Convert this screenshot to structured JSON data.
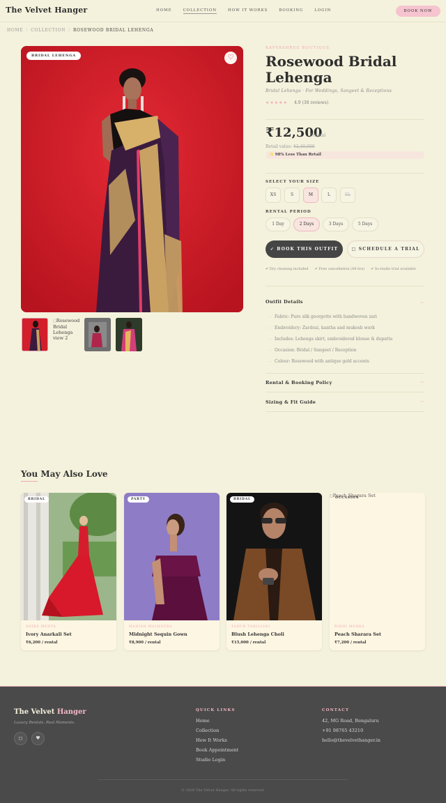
{
  "header": {
    "logo": "The Velvet Hanger",
    "nav": [
      "HOME",
      "COLLECTION",
      "HOW IT WORKS",
      "BOOKING",
      "LOGIN"
    ],
    "book_now": "BOOK NOW"
  },
  "breadcrumb": [
    "HOME",
    "COLLECTION",
    "ROSEWOOD BRIDAL LEHENGA"
  ],
  "product": {
    "badge": "BRIDAL LEHENGA",
    "designer": "KAVYASHREE BOUTIQUE",
    "title_line1": "Rosewood Bridal",
    "title_line2": "Lehenga",
    "subtitle": "Bridal Lehenga · For Weddings, Sangeet & Receptions",
    "stars": "★★★★★",
    "rating": "4.9 (38 reviews)",
    "price": "₹12,500",
    "price_unit": "/ rental",
    "retail_label": "Retail value:",
    "retail_value": "₹2,40,000",
    "saving": "✨ 98% Less Than Retail",
    "thumb_alt": "Rosewood Bridal Lehenga view 2"
  },
  "size": {
    "label": "SELECT YOUR SIZE",
    "options": [
      "XS",
      "S",
      "M",
      "L",
      "XL"
    ],
    "selected": "M",
    "unavailable": "XL"
  },
  "period": {
    "label": "RENTAL PERIOD",
    "options": [
      "1 Day",
      "2 Days",
      "3 Days",
      "5 Days"
    ],
    "selected": "2 Days"
  },
  "actions": {
    "book": "✓ BOOK THIS OUTFIT",
    "trial": "□ SCHEDULE A TRIAL"
  },
  "perks": [
    "✔ Dry cleaning included",
    "✔ Free cancellation (48 hrs)",
    "✔ In-studio trial available"
  ],
  "accordion": {
    "details_title": "Outfit Details",
    "details": [
      "Fabric: Pure silk georgette with handwoven zari",
      "Embroidery: Zardozi, kantha and mukesh work",
      "Includes: Lehenga skirt, embroidered blouse & dupatta",
      "Occasion: Bridal / Sangeet / Reception",
      "Colour: Rosewood with antique gold accents"
    ],
    "policy_title": "Rental & Booking Policy",
    "sizing_title": "Sizing & Fit Guide"
  },
  "recommendations": {
    "title": "You May Also Love",
    "cards": [
      {
        "badge": "BRIDAL",
        "designer": "ANIKA MEHTA",
        "name": "Ivory Anarkali Set",
        "price": "₹6,200",
        "unit": "/ rental"
      },
      {
        "badge": "PARTY",
        "designer": "MANISH MALHOTRA",
        "name": "Midnight Sequin Gown",
        "price": "₹8,900",
        "unit": "/ rental"
      },
      {
        "badge": "BRIDAL",
        "designer": "TARUN TAHILIANI",
        "name": "Blush Lehenga Choli",
        "price": "₹15,000",
        "unit": "/ rental"
      },
      {
        "badge": "OCCASION",
        "designer": "RIDHI MEHRA",
        "name": "Peach Sharara Set",
        "price": "₹7,200",
        "unit": "/ rental",
        "alt": "Peach Sharara Set"
      }
    ]
  },
  "footer": {
    "brand1": "The Velvet",
    "brand2": "Hanger",
    "tagline": "Luxury Rentals. Real Moments.",
    "quick_head": "QUICK LINKS",
    "quick_links": [
      "Home",
      "Collection",
      "How It Works",
      "Book Appointment",
      "Studio Login"
    ],
    "contact_head": "CONTACT",
    "contact": [
      "42, MG Road, Bengaluru",
      "+91 98765 43210",
      "hello@thevelvethanger.in"
    ],
    "copyright": "© 2026 The Velvet Hanger. All rights reserved."
  },
  "colors": {
    "accent": "#f0a7b8",
    "button_dark": "#454545",
    "background": "#f4f2dc",
    "footer": "#4a4a4a"
  }
}
